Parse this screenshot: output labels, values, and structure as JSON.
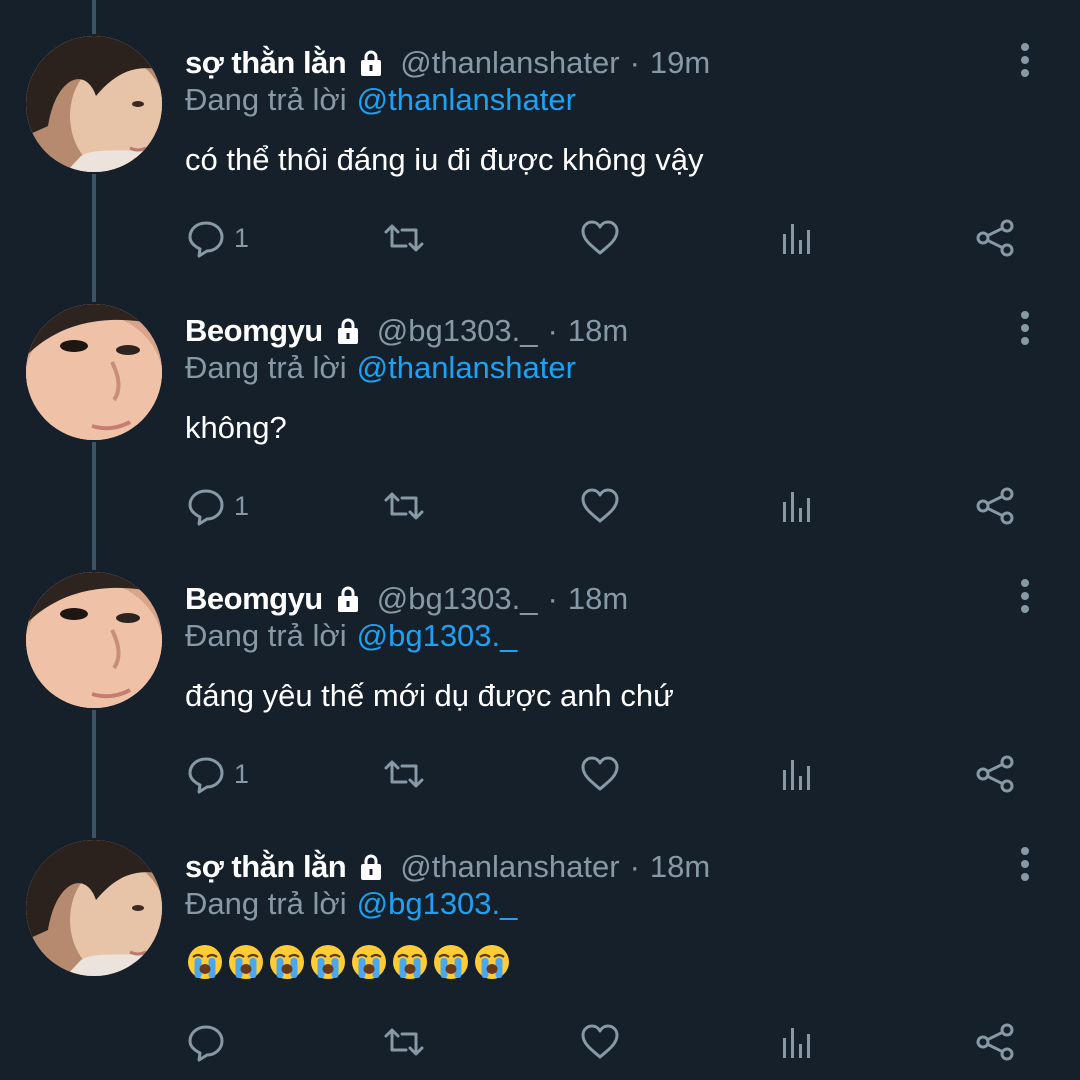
{
  "tweets": [
    {
      "name": "sợ thằn lằn",
      "handle": "@thanlanshater",
      "separator": "·",
      "time": "19m",
      "reply_prefix": "Đang trả lời",
      "reply_to": "@thanlanshater",
      "text": "có thể thôi đáng iu đi được không vậy",
      "reply_count": "1",
      "avatar": "thanlanshater-avatar"
    },
    {
      "name": "Beomgyu",
      "handle": "@bg1303._",
      "separator": "·",
      "time": "18m",
      "reply_prefix": "Đang trả lời",
      "reply_to": "@thanlanshater",
      "text": "không?",
      "reply_count": "1",
      "avatar": "bg1303-avatar"
    },
    {
      "name": "Beomgyu",
      "handle": "@bg1303._",
      "separator": "·",
      "time": "18m",
      "reply_prefix": "Đang trả lời",
      "reply_to": "@bg1303._",
      "text": "đáng yêu thế mới dụ được anh chứ",
      "reply_count": "1",
      "avatar": "bg1303-avatar"
    },
    {
      "name": "sợ thằn lằn",
      "handle": "@thanlanshater",
      "separator": "·",
      "time": "18m",
      "reply_prefix": "Đang trả lời",
      "reply_to": "@bg1303._",
      "emoji_text": "😭😭😭😭😭😭😭😭",
      "reply_count": "",
      "avatar": "thanlanshater-avatar"
    }
  ],
  "icons": {
    "lock": "lock-icon",
    "more": "more-vertical-icon",
    "reply": "reply-icon",
    "retweet": "retweet-icon",
    "like": "heart-icon",
    "analytics": "analytics-icon",
    "share": "share-icon"
  },
  "colors": {
    "background": "#15202b",
    "secondary_text": "#8899a6",
    "mention": "#1da1f2",
    "thread_line": "#3d5466"
  }
}
